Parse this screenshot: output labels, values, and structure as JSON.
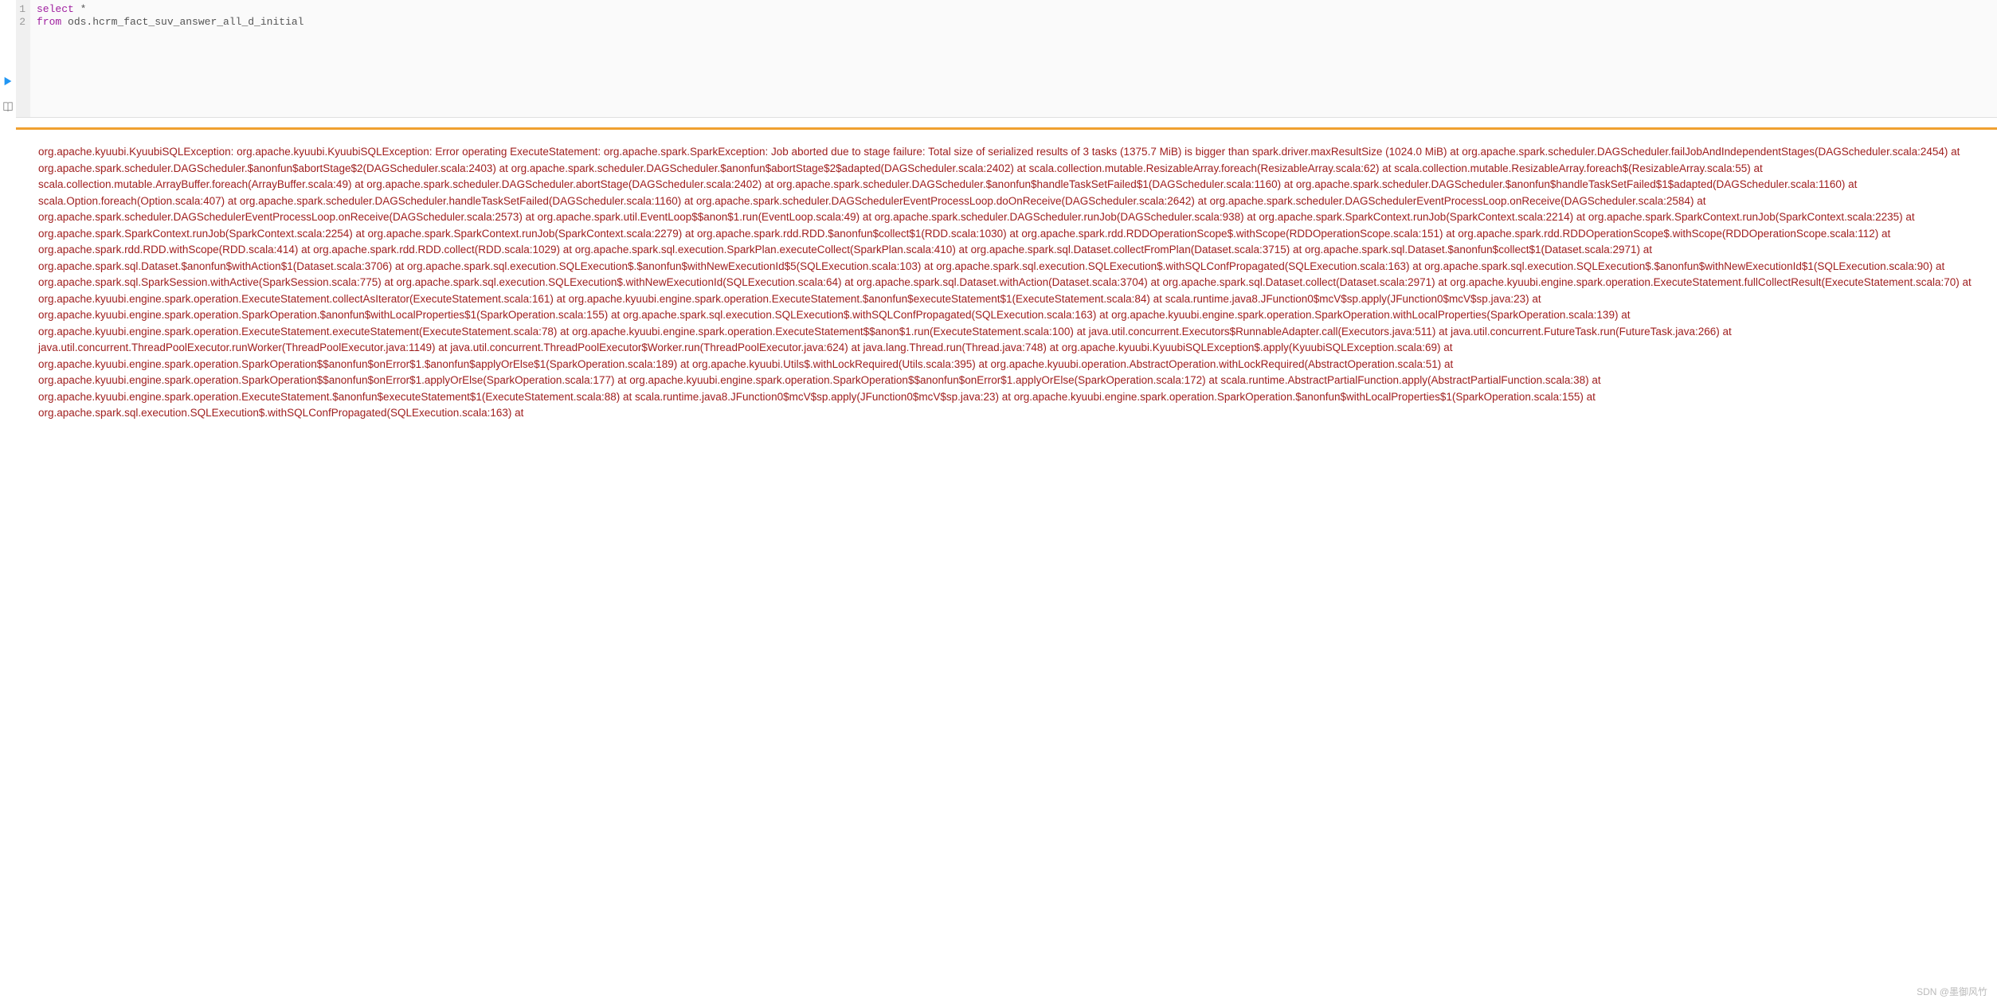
{
  "editor": {
    "line_numbers": [
      "1",
      "2"
    ],
    "code_line1_kw": "select",
    "code_line1_rest": " *",
    "code_line2_kw": "from",
    "code_line2_rest": " ods.hcrm_fact_suv_answer_all_d_initial"
  },
  "error": {
    "text": "org.apache.kyuubi.KyuubiSQLException: org.apache.kyuubi.KyuubiSQLException: Error operating ExecuteStatement: org.apache.spark.SparkException: Job aborted due to stage failure: Total size of serialized results of 3 tasks (1375.7 MiB) is bigger than spark.driver.maxResultSize (1024.0 MiB) at org.apache.spark.scheduler.DAGScheduler.failJobAndIndependentStages(DAGScheduler.scala:2454) at org.apache.spark.scheduler.DAGScheduler.$anonfun$abortStage$2(DAGScheduler.scala:2403) at org.apache.spark.scheduler.DAGScheduler.$anonfun$abortStage$2$adapted(DAGScheduler.scala:2402) at scala.collection.mutable.ResizableArray.foreach(ResizableArray.scala:62) at scala.collection.mutable.ResizableArray.foreach$(ResizableArray.scala:55) at scala.collection.mutable.ArrayBuffer.foreach(ArrayBuffer.scala:49) at org.apache.spark.scheduler.DAGScheduler.abortStage(DAGScheduler.scala:2402) at org.apache.spark.scheduler.DAGScheduler.$anonfun$handleTaskSetFailed$1(DAGScheduler.scala:1160) at org.apache.spark.scheduler.DAGScheduler.$anonfun$handleTaskSetFailed$1$adapted(DAGScheduler.scala:1160) at scala.Option.foreach(Option.scala:407) at org.apache.spark.scheduler.DAGScheduler.handleTaskSetFailed(DAGScheduler.scala:1160) at org.apache.spark.scheduler.DAGSchedulerEventProcessLoop.doOnReceive(DAGScheduler.scala:2642) at org.apache.spark.scheduler.DAGSchedulerEventProcessLoop.onReceive(DAGScheduler.scala:2584) at org.apache.spark.scheduler.DAGSchedulerEventProcessLoop.onReceive(DAGScheduler.scala:2573) at org.apache.spark.util.EventLoop$$anon$1.run(EventLoop.scala:49) at org.apache.spark.scheduler.DAGScheduler.runJob(DAGScheduler.scala:938) at org.apache.spark.SparkContext.runJob(SparkContext.scala:2214) at org.apache.spark.SparkContext.runJob(SparkContext.scala:2235) at org.apache.spark.SparkContext.runJob(SparkContext.scala:2254) at org.apache.spark.SparkContext.runJob(SparkContext.scala:2279) at org.apache.spark.rdd.RDD.$anonfun$collect$1(RDD.scala:1030) at org.apache.spark.rdd.RDDOperationScope$.withScope(RDDOperationScope.scala:151) at org.apache.spark.rdd.RDDOperationScope$.withScope(RDDOperationScope.scala:112) at org.apache.spark.rdd.RDD.withScope(RDD.scala:414) at org.apache.spark.rdd.RDD.collect(RDD.scala:1029) at org.apache.spark.sql.execution.SparkPlan.executeCollect(SparkPlan.scala:410) at org.apache.spark.sql.Dataset.collectFromPlan(Dataset.scala:3715) at org.apache.spark.sql.Dataset.$anonfun$collect$1(Dataset.scala:2971) at org.apache.spark.sql.Dataset.$anonfun$withAction$1(Dataset.scala:3706) at org.apache.spark.sql.execution.SQLExecution$.$anonfun$withNewExecutionId$5(SQLExecution.scala:103) at org.apache.spark.sql.execution.SQLExecution$.withSQLConfPropagated(SQLExecution.scala:163) at org.apache.spark.sql.execution.SQLExecution$.$anonfun$withNewExecutionId$1(SQLExecution.scala:90) at org.apache.spark.sql.SparkSession.withActive(SparkSession.scala:775) at org.apache.spark.sql.execution.SQLExecution$.withNewExecutionId(SQLExecution.scala:64) at org.apache.spark.sql.Dataset.withAction(Dataset.scala:3704) at org.apache.spark.sql.Dataset.collect(Dataset.scala:2971) at org.apache.kyuubi.engine.spark.operation.ExecuteStatement.fullCollectResult(ExecuteStatement.scala:70) at org.apache.kyuubi.engine.spark.operation.ExecuteStatement.collectAsIterator(ExecuteStatement.scala:161) at org.apache.kyuubi.engine.spark.operation.ExecuteStatement.$anonfun$executeStatement$1(ExecuteStatement.scala:84) at scala.runtime.java8.JFunction0$mcV$sp.apply(JFunction0$mcV$sp.java:23) at org.apache.kyuubi.engine.spark.operation.SparkOperation.$anonfun$withLocalProperties$1(SparkOperation.scala:155) at org.apache.spark.sql.execution.SQLExecution$.withSQLConfPropagated(SQLExecution.scala:163) at org.apache.kyuubi.engine.spark.operation.SparkOperation.withLocalProperties(SparkOperation.scala:139) at org.apache.kyuubi.engine.spark.operation.ExecuteStatement.executeStatement(ExecuteStatement.scala:78) at org.apache.kyuubi.engine.spark.operation.ExecuteStatement$$anon$1.run(ExecuteStatement.scala:100) at java.util.concurrent.Executors$RunnableAdapter.call(Executors.java:511) at java.util.concurrent.FutureTask.run(FutureTask.java:266) at java.util.concurrent.ThreadPoolExecutor.runWorker(ThreadPoolExecutor.java:1149) at java.util.concurrent.ThreadPoolExecutor$Worker.run(ThreadPoolExecutor.java:624) at java.lang.Thread.run(Thread.java:748) at org.apache.kyuubi.KyuubiSQLException$.apply(KyuubiSQLException.scala:69) at org.apache.kyuubi.engine.spark.operation.SparkOperation$$anonfun$onError$1.$anonfun$applyOrElse$1(SparkOperation.scala:189) at org.apache.kyuubi.Utils$.withLockRequired(Utils.scala:395) at org.apache.kyuubi.operation.AbstractOperation.withLockRequired(AbstractOperation.scala:51) at org.apache.kyuubi.engine.spark.operation.SparkOperation$$anonfun$onError$1.applyOrElse(SparkOperation.scala:177) at org.apache.kyuubi.engine.spark.operation.SparkOperation$$anonfun$onError$1.applyOrElse(SparkOperation.scala:172) at scala.runtime.AbstractPartialFunction.apply(AbstractPartialFunction.scala:38) at org.apache.kyuubi.engine.spark.operation.ExecuteStatement.$anonfun$executeStatement$1(ExecuteStatement.scala:88) at scala.runtime.java8.JFunction0$mcV$sp.apply(JFunction0$mcV$sp.java:23) at org.apache.kyuubi.engine.spark.operation.SparkOperation.$anonfun$withLocalProperties$1(SparkOperation.scala:155) at org.apache.spark.sql.execution.SQLExecution$.withSQLConfPropagated(SQLExecution.scala:163) at"
  },
  "watermark": "SDN @墨御风竹"
}
